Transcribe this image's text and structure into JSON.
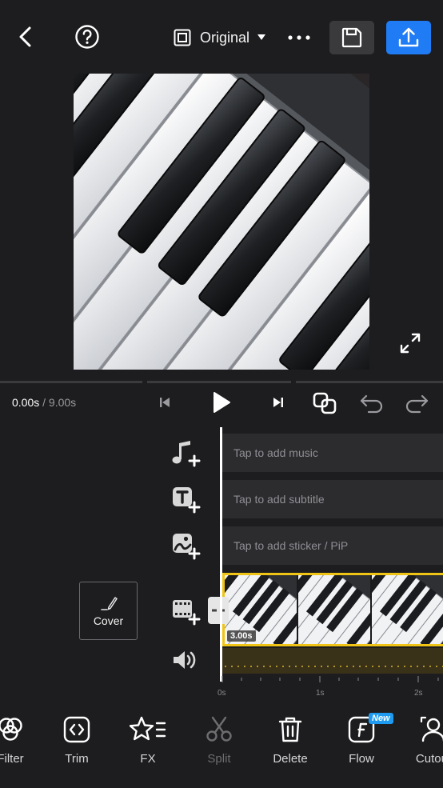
{
  "topbar": {
    "ratio_label": "Original",
    "icons": {
      "back": "chevron-left-icon",
      "help": "question-circle-icon",
      "ratio": "aspect-ratio-icon",
      "dropdown": "triangle-down-icon",
      "more": "more-horizontal-icon",
      "save": "floppy-disk-icon",
      "export": "upload-icon"
    },
    "colors": {
      "export_bg": "#1f7cf5",
      "save_bg": "#3a3a3d"
    }
  },
  "player": {
    "current_time": "0.00s",
    "total_time": " / 9.00s"
  },
  "tracks": {
    "music_hint": "Tap to add music",
    "subtitle_hint": "Tap to add subtitle",
    "sticker_hint": "Tap to add sticker / PiP"
  },
  "timeline": {
    "cover_label": "Cover",
    "clip_duration": "3.00s",
    "ruler": [
      "0s",
      "1s",
      "2s"
    ],
    "colors": {
      "clip_border": "#f0c414",
      "audio_bg": "#3a3218"
    }
  },
  "toolbar": {
    "items": [
      {
        "label": "Filter",
        "icon": "filter-icon"
      },
      {
        "label": "Trim",
        "icon": "trim-icon"
      },
      {
        "label": "FX",
        "icon": "fx-star-icon"
      },
      {
        "label": "Split",
        "icon": "scissors-icon"
      },
      {
        "label": "Delete",
        "icon": "trash-icon"
      },
      {
        "label": "Flow",
        "icon": "flow-icon",
        "badge": "New"
      },
      {
        "label": "Cutout",
        "icon": "cutout-person-icon"
      }
    ]
  }
}
